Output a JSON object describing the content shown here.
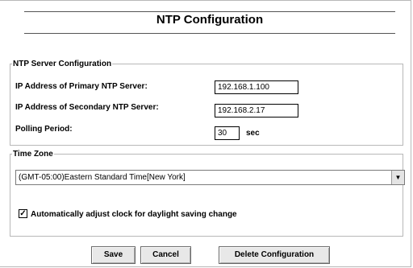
{
  "page": {
    "title": "NTP Configuration"
  },
  "ntp_server": {
    "legend": "NTP Server Configuration",
    "primary_label": "IP Address of Primary NTP Server:",
    "primary_value": "192.168.1.100",
    "secondary_label": "IP Address of Secondary NTP Server:",
    "secondary_value": "192.168.2.17",
    "polling_label": "Polling Period:",
    "polling_value": "30",
    "polling_unit": "sec"
  },
  "time_zone": {
    "legend": "Time Zone",
    "selected": "(GMT-05:00)Eastern Standard Time[New York]",
    "dst_checked": true,
    "dst_label": "Automatically adjust clock for daylight saving change"
  },
  "buttons": {
    "save": "Save",
    "cancel": "Cancel",
    "delete": "Delete Configuration"
  }
}
